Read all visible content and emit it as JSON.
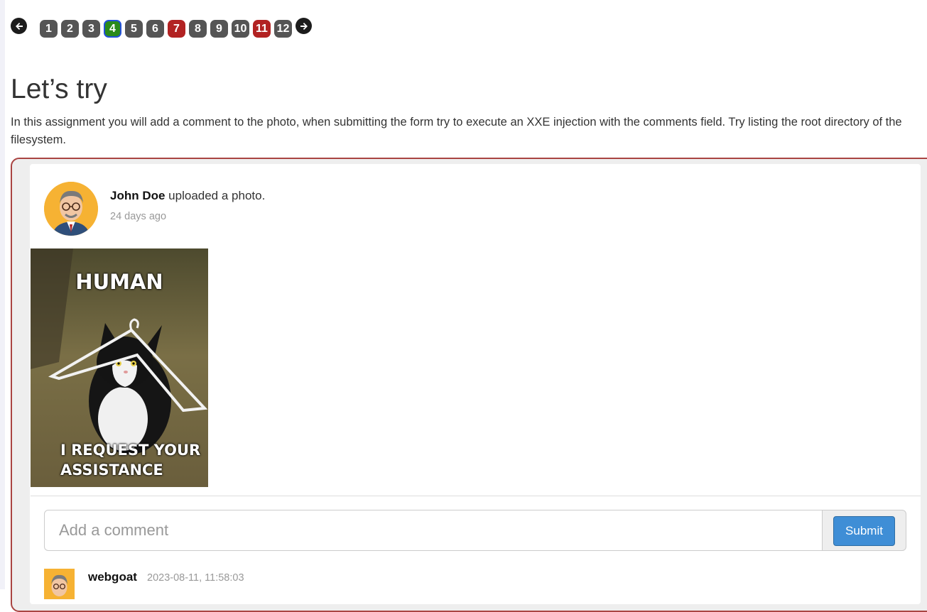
{
  "pager": {
    "pages": [
      {
        "label": "1",
        "state": "default"
      },
      {
        "label": "2",
        "state": "default"
      },
      {
        "label": "3",
        "state": "default"
      },
      {
        "label": "4",
        "state": "current"
      },
      {
        "label": "5",
        "state": "default"
      },
      {
        "label": "6",
        "state": "default"
      },
      {
        "label": "7",
        "state": "solved"
      },
      {
        "label": "8",
        "state": "default"
      },
      {
        "label": "9",
        "state": "default"
      },
      {
        "label": "10",
        "state": "default"
      },
      {
        "label": "11",
        "state": "solved"
      },
      {
        "label": "12",
        "state": "default"
      }
    ],
    "prev_icon": "arrow-left-icon",
    "next_icon": "arrow-right-icon",
    "colors": {
      "default": "#555555",
      "solved": "#b22222",
      "current": "#2a8a1a",
      "current_border": "#2350d8"
    }
  },
  "lesson": {
    "title": "Let’s try",
    "description": "In this assignment you will add a comment to the photo, when submitting the form try to execute an XXE injection with the comments field. Try listing the root directory of the filesystem."
  },
  "post": {
    "author": "John Doe",
    "action": " uploaded a photo.",
    "time": "24 days ago",
    "photo_top_text": "HUMAN",
    "photo_bottom_line1": "I REQUEST YOUR",
    "photo_bottom_line2": "ASSISTANCE"
  },
  "comment_form": {
    "placeholder": "Add a comment",
    "submit_label": "Submit"
  },
  "comments": [
    {
      "user": "webgoat",
      "time": "2023-08-11, 11:58:03"
    }
  ],
  "colors": {
    "frame_border": "#a94442",
    "submit": "#3f8ed6"
  }
}
